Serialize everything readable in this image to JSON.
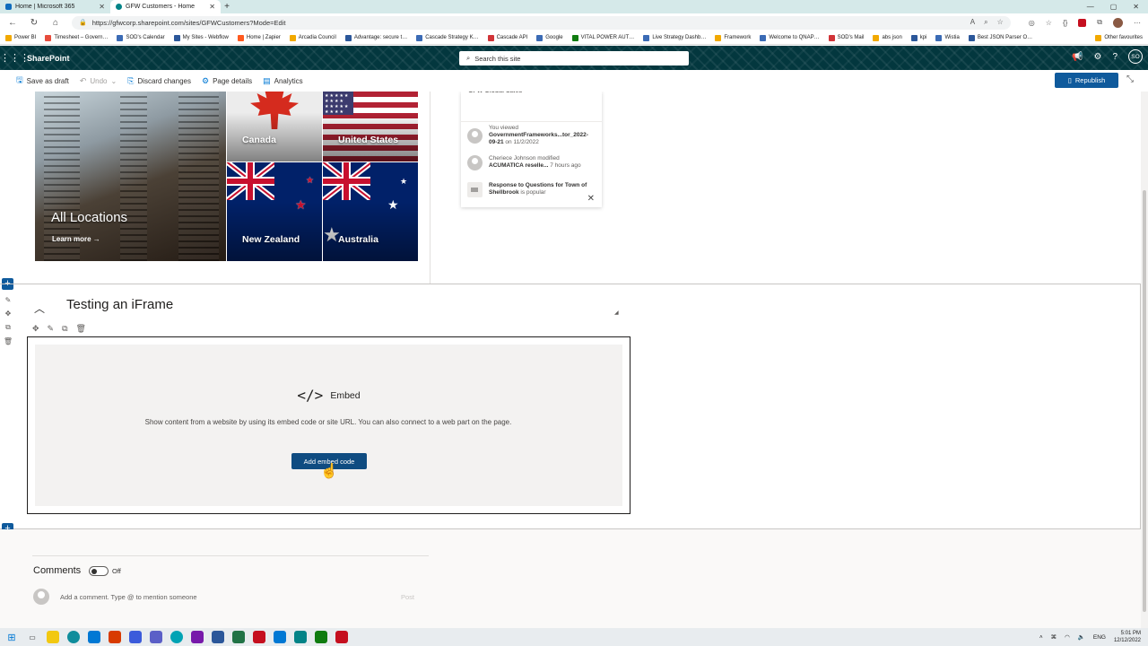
{
  "browser": {
    "tabs": [
      {
        "title": "Home | Microsoft 365",
        "active": false
      },
      {
        "title": "GFW Customers - Home",
        "active": true
      }
    ],
    "url": "https://gfwcorp.sharepoint.com/sites/GFWCustomers?Mode=Edit",
    "bookmarks": [
      "Power BI",
      "Timesheet – Govern…",
      "SOD's Calendar",
      "My Sites - Webflow",
      "Home | Zapier",
      "Arcadia Council",
      "Advantage: secure t…",
      "Cascade Strategy K…",
      "Cascade API",
      "Google",
      "VITAL POWER AUT…",
      "Live Strategy Dashb…",
      "Framework",
      "Welcome to QNAP…",
      "SOD's Mail",
      "abs json",
      "kpi",
      "Wistia",
      "Best JSON Parser O…"
    ],
    "other_bookmarks": "Other favourites"
  },
  "suite": {
    "app_name": "SharePoint",
    "search_placeholder": "Search this site",
    "user_initials": "SO"
  },
  "commandbar": {
    "save_draft": "Save as draft",
    "undo": "Undo",
    "discard": "Discard changes",
    "page_details": "Page details",
    "analytics": "Analytics",
    "republish": "Republish"
  },
  "hero": {
    "main_title": "All Locations",
    "learn_more": "Learn more →",
    "tiles": [
      "Canada",
      "United States",
      "New Zealand",
      "Australia"
    ]
  },
  "activity": {
    "header": "GFW Global Sales",
    "items": [
      {
        "line1": "You viewed",
        "bold": "GovernmentFrameworks...tor_2022-09-21",
        "suffix": " on 11/2/2022"
      },
      {
        "line1": "Cheriece Johnson modified",
        "bold": "ACUMATICA reselle...",
        "suffix": " 7 hours ago"
      },
      {
        "line1": "",
        "bold": "Response to Questions for Town of Shellbrook",
        "suffix": " is popular"
      }
    ]
  },
  "section": {
    "title": "Testing an iFrame",
    "embed": {
      "icon": "</>",
      "name": "Embed",
      "description": "Show content from a website by using its embed code or site URL. You can also connect to a web part on the page.",
      "button": "Add embed code"
    }
  },
  "comments": {
    "title": "Comments",
    "toggle_state": "Off",
    "placeholder": "Add a comment. Type @ to mention someone",
    "post": "Post"
  },
  "taskbar": {
    "lang": "ENG",
    "time": "5:01 PM",
    "date": "12/12/2022"
  },
  "colors": {
    "accent": "#0f5a9c",
    "suite_bar": "#03373e"
  }
}
